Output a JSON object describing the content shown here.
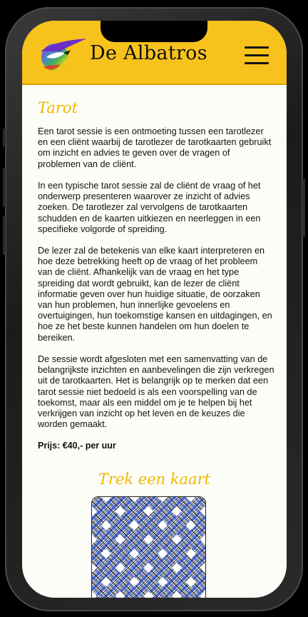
{
  "header": {
    "brand": "De Albatros",
    "logo_icon": "albatross-logo-icon",
    "menu_icon": "hamburger-menu-icon"
  },
  "main": {
    "title": "Tarot",
    "paragraphs": [
      "Een tarot sessie is een ontmoeting tussen een tarotlezer en een cliënt waarbij de tarotlezer de tarotkaarten gebruikt om inzicht en advies te geven over de vragen of problemen van de cliënt.",
      "In een typische tarot sessie zal de cliënt de vraag of het onderwerp presenteren waarover ze inzicht of advies zoeken. De tarotlezer zal vervolgens de tarotkaarten schudden en de kaarten uitkiezen en neerleggen in een specifieke volgorde of spreiding.",
      "De lezer zal de betekenis van elke kaart interpreteren en hoe deze betrekking heeft op de vraag of het probleem van de cliënt. Afhankelijk van de vraag en het type spreiding dat wordt gebruikt, kan de lezer de cliënt informatie geven over hun huidige situatie, de oorzaken van hun problemen, hun innerlijke gevoelens en overtuigingen, hun toekomstige kansen en uitdagingen, en hoe ze het beste kunnen handelen om hun doelen te bereiken.",
      "De sessie wordt afgesloten met een samenvatting van de belangrijkste inzichten en aanbevelingen die zijn verkregen uit de tarotkaarten. Het is belangrijk op te merken dat een tarot sessie niet bedoeld is als een voorspelling van de toekomst, maar als een middel om je te helpen bij het verkrijgen van inzicht op het leven en de keuzes die worden gemaakt."
    ],
    "price": "Prijs: €40,- per uur"
  },
  "draw": {
    "title": "Trek een kaart",
    "card_back": "tarot-card-back-pattern",
    "colors": {
      "accent": "#f8c21c",
      "heading": "#f0b800",
      "card_blue": "#4f6fd0"
    }
  }
}
